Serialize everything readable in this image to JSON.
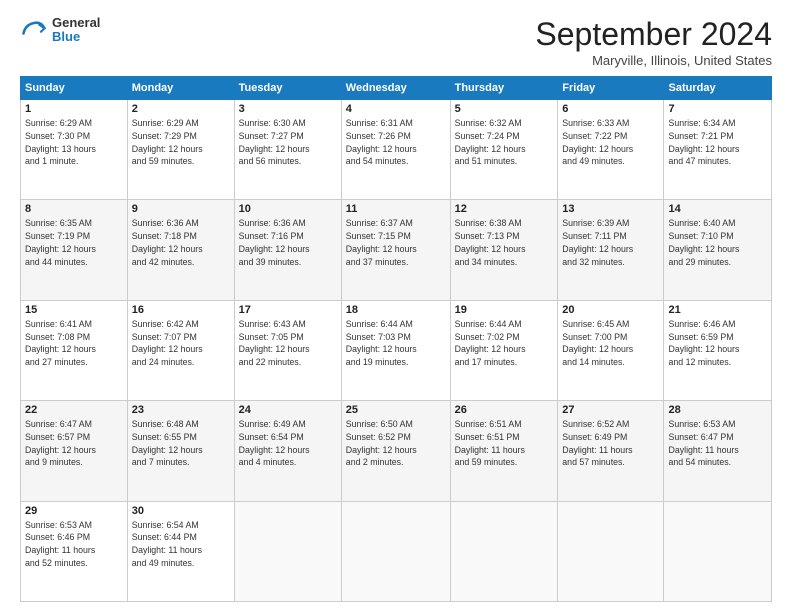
{
  "header": {
    "logo_general": "General",
    "logo_blue": "Blue",
    "month_title": "September 2024",
    "location": "Maryville, Illinois, United States"
  },
  "weekdays": [
    "Sunday",
    "Monday",
    "Tuesday",
    "Wednesday",
    "Thursday",
    "Friday",
    "Saturday"
  ],
  "weeks": [
    [
      {
        "day": "1",
        "sunrise": "6:29 AM",
        "sunset": "7:30 PM",
        "daylight": "13 hours and 1 minute."
      },
      {
        "day": "2",
        "sunrise": "6:29 AM",
        "sunset": "7:29 PM",
        "daylight": "12 hours and 59 minutes."
      },
      {
        "day": "3",
        "sunrise": "6:30 AM",
        "sunset": "7:27 PM",
        "daylight": "12 hours and 56 minutes."
      },
      {
        "day": "4",
        "sunrise": "6:31 AM",
        "sunset": "7:26 PM",
        "daylight": "12 hours and 54 minutes."
      },
      {
        "day": "5",
        "sunrise": "6:32 AM",
        "sunset": "7:24 PM",
        "daylight": "12 hours and 51 minutes."
      },
      {
        "day": "6",
        "sunrise": "6:33 AM",
        "sunset": "7:22 PM",
        "daylight": "12 hours and 49 minutes."
      },
      {
        "day": "7",
        "sunrise": "6:34 AM",
        "sunset": "7:21 PM",
        "daylight": "12 hours and 47 minutes."
      }
    ],
    [
      {
        "day": "8",
        "sunrise": "6:35 AM",
        "sunset": "7:19 PM",
        "daylight": "12 hours and 44 minutes."
      },
      {
        "day": "9",
        "sunrise": "6:36 AM",
        "sunset": "7:18 PM",
        "daylight": "12 hours and 42 minutes."
      },
      {
        "day": "10",
        "sunrise": "6:36 AM",
        "sunset": "7:16 PM",
        "daylight": "12 hours and 39 minutes."
      },
      {
        "day": "11",
        "sunrise": "6:37 AM",
        "sunset": "7:15 PM",
        "daylight": "12 hours and 37 minutes."
      },
      {
        "day": "12",
        "sunrise": "6:38 AM",
        "sunset": "7:13 PM",
        "daylight": "12 hours and 34 minutes."
      },
      {
        "day": "13",
        "sunrise": "6:39 AM",
        "sunset": "7:11 PM",
        "daylight": "12 hours and 32 minutes."
      },
      {
        "day": "14",
        "sunrise": "6:40 AM",
        "sunset": "7:10 PM",
        "daylight": "12 hours and 29 minutes."
      }
    ],
    [
      {
        "day": "15",
        "sunrise": "6:41 AM",
        "sunset": "7:08 PM",
        "daylight": "12 hours and 27 minutes."
      },
      {
        "day": "16",
        "sunrise": "6:42 AM",
        "sunset": "7:07 PM",
        "daylight": "12 hours and 24 minutes."
      },
      {
        "day": "17",
        "sunrise": "6:43 AM",
        "sunset": "7:05 PM",
        "daylight": "12 hours and 22 minutes."
      },
      {
        "day": "18",
        "sunrise": "6:44 AM",
        "sunset": "7:03 PM",
        "daylight": "12 hours and 19 minutes."
      },
      {
        "day": "19",
        "sunrise": "6:44 AM",
        "sunset": "7:02 PM",
        "daylight": "12 hours and 17 minutes."
      },
      {
        "day": "20",
        "sunrise": "6:45 AM",
        "sunset": "7:00 PM",
        "daylight": "12 hours and 14 minutes."
      },
      {
        "day": "21",
        "sunrise": "6:46 AM",
        "sunset": "6:59 PM",
        "daylight": "12 hours and 12 minutes."
      }
    ],
    [
      {
        "day": "22",
        "sunrise": "6:47 AM",
        "sunset": "6:57 PM",
        "daylight": "12 hours and 9 minutes."
      },
      {
        "day": "23",
        "sunrise": "6:48 AM",
        "sunset": "6:55 PM",
        "daylight": "12 hours and 7 minutes."
      },
      {
        "day": "24",
        "sunrise": "6:49 AM",
        "sunset": "6:54 PM",
        "daylight": "12 hours and 4 minutes."
      },
      {
        "day": "25",
        "sunrise": "6:50 AM",
        "sunset": "6:52 PM",
        "daylight": "12 hours and 2 minutes."
      },
      {
        "day": "26",
        "sunrise": "6:51 AM",
        "sunset": "6:51 PM",
        "daylight": "11 hours and 59 minutes."
      },
      {
        "day": "27",
        "sunrise": "6:52 AM",
        "sunset": "6:49 PM",
        "daylight": "11 hours and 57 minutes."
      },
      {
        "day": "28",
        "sunrise": "6:53 AM",
        "sunset": "6:47 PM",
        "daylight": "11 hours and 54 minutes."
      }
    ],
    [
      {
        "day": "29",
        "sunrise": "6:53 AM",
        "sunset": "6:46 PM",
        "daylight": "11 hours and 52 minutes."
      },
      {
        "day": "30",
        "sunrise": "6:54 AM",
        "sunset": "6:44 PM",
        "daylight": "11 hours and 49 minutes."
      },
      null,
      null,
      null,
      null,
      null
    ]
  ]
}
